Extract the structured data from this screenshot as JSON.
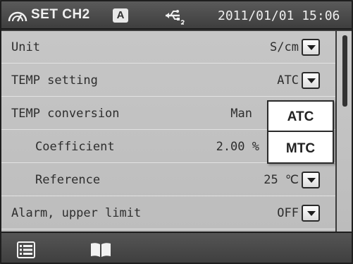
{
  "statusbar": {
    "title": "SET CH2",
    "channel_badge": "A",
    "datetime": "2011/01/01 15:06",
    "icons": [
      "meter-gauge-icon",
      "usb-icon"
    ]
  },
  "settings": [
    {
      "label": "Unit",
      "value": "S/cm"
    },
    {
      "label": "TEMP setting",
      "value": "ATC"
    },
    {
      "label": "TEMP conversion",
      "value": "Man"
    },
    {
      "label": "Coefficient",
      "value": "2.00 %"
    },
    {
      "label": "Reference",
      "value": "25  ℃"
    },
    {
      "label": "Alarm, upper limit",
      "value": "OFF"
    }
  ],
  "popup": {
    "options": [
      "ATC",
      "MTC"
    ]
  },
  "scrollbar": {
    "position_fraction": 0.0,
    "visible_fraction": 0.37
  },
  "bottombar": {
    "icons": [
      "list-icon",
      "book-icon"
    ]
  },
  "colors": {
    "list_background": "#c3c3c3",
    "bar_background": "#4a4a4a",
    "text": "#2e2e2e"
  }
}
